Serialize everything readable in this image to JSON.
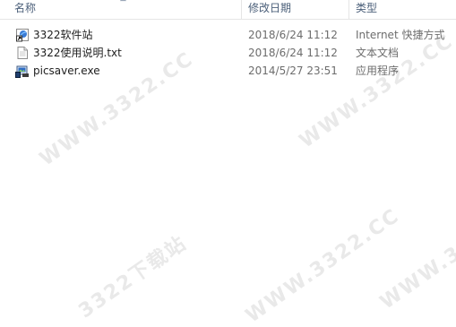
{
  "columns": {
    "name": "名称",
    "date": "修改日期",
    "type": "类型"
  },
  "files": [
    {
      "name": "3322软件站",
      "date": "2018/6/24 11:12",
      "type": "Internet 快捷方式",
      "icon": "shortcut-icon"
    },
    {
      "name": "3322使用说明.txt",
      "date": "2018/6/24 11:12",
      "type": "文本文档",
      "icon": "text-file-icon"
    },
    {
      "name": "picsaver.exe",
      "date": "2014/5/27 23:51",
      "type": "应用程序",
      "icon": "app-icon"
    }
  ],
  "watermark": "WWW.3322.CC",
  "watermark_alt": "3322下载站"
}
